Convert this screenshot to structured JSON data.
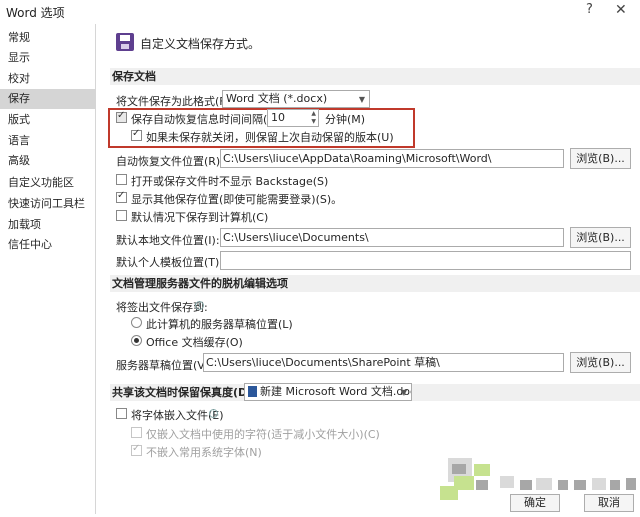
{
  "window": {
    "title": "Word 选项",
    "help": "?",
    "close": "✕"
  },
  "sidebar": {
    "items": [
      {
        "label": "常规"
      },
      {
        "label": "显示"
      },
      {
        "label": "校对"
      },
      {
        "label": "保存",
        "active": true
      },
      {
        "label": "版式"
      },
      {
        "label": "语言"
      },
      {
        "label": "高级"
      },
      {
        "label": "自定义功能区"
      },
      {
        "label": "快速访问工具栏"
      },
      {
        "label": "加载项"
      },
      {
        "label": "信任中心"
      }
    ]
  },
  "header": {
    "icon": "save-icon",
    "text": "自定义文档保存方式。"
  },
  "save_docs": {
    "section_title": "保存文档",
    "format_label": "将文件保存为此格式(F):",
    "format_value": "Word 文档 (*.docx)",
    "autorecover_label": "保存自动恢复信息时间间隔(A)",
    "autorecover_checked": true,
    "autorecover_minutes": "10",
    "minutes_label": "分钟(M)",
    "keep_last_label": "如果未保存就关闭，则保留上次自动保留的版本(U)",
    "keep_last_checked": true,
    "autorecover_path_label": "自动恢复文件位置(R):",
    "autorecover_path": "C:\\Users\\liuce\\AppData\\Roaming\\Microsoft\\Word\\",
    "browse_label": "浏览(B)...",
    "no_backstage_label": "打开或保存文件时不显示 Backstage(S)",
    "no_backstage_checked": false,
    "show_other_label": "显示其他保存位置(即使可能需要登录)(S)。",
    "show_other_checked": true,
    "default_computer_label": "默认情况下保存到计算机(C)",
    "default_computer_checked": false,
    "local_path_label": "默认本地文件位置(I):",
    "local_path": "C:\\Users\\liuce\\Documents\\",
    "browse2_label": "浏览(B)...",
    "template_label": "默认个人模板位置(T):",
    "template_path": ""
  },
  "offline": {
    "section_title": "文档管理服务器文件的脱机编辑选项",
    "checkout_label": "将签出文件保存到:",
    "server_drafts_label": "此计算机的服务器草稿位置(L)",
    "server_drafts_checked": false,
    "office_cache_label": "Office 文档缓存(O)",
    "office_cache_checked": true,
    "drafts_location_label": "服务器草稿位置(V):",
    "drafts_location": "C:\\Users\\liuce\\Documents\\SharePoint 草稿\\",
    "browse3_label": "浏览(B)..."
  },
  "fidelity": {
    "section_title": "共享该文档时保留保真度(D):",
    "doc_value": "新建 Microsoft Word 文档.docx",
    "embed_fonts_label": "将字体嵌入文件(E)",
    "embed_fonts_checked": false,
    "embed_used_chars_label": "仅嵌入文档中使用的字符(适于减小文件大小)(C)",
    "embed_used_chars_checked": false,
    "no_common_fonts_label": "不嵌入常用系统字体(N)",
    "no_common_fonts_checked": true
  },
  "footer": {
    "ok": "确定",
    "cancel": "取消"
  },
  "colors": {
    "highlight_border": "#c0392b",
    "active_nav": "#d5d5d5",
    "section_bg": "#f0f0f0"
  }
}
